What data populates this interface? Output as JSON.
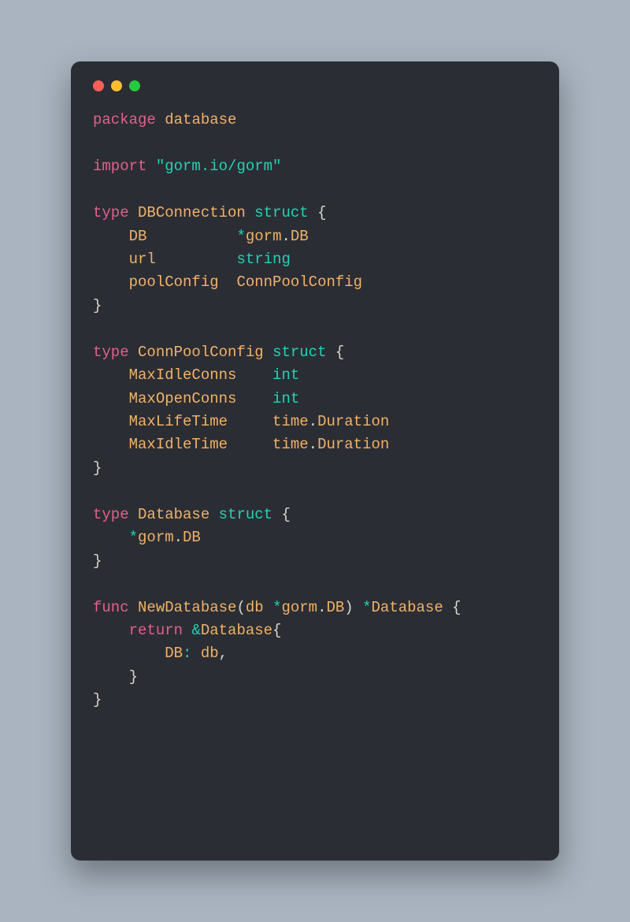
{
  "window": {
    "dots": [
      "red",
      "yellow",
      "green"
    ]
  },
  "code": {
    "l1_kw": "package",
    "l1_name": "database",
    "l3_kw": "import",
    "l3_str": "\"gorm.io/gorm\"",
    "l5_kw_type": "type",
    "l5_name": "DBConnection",
    "l5_kw_struct": "struct",
    "l6_field": "DB",
    "l6_star": "*",
    "l6_pkg": "gorm",
    "l6_dot": ".",
    "l6_type": "DB",
    "l7_field": "url",
    "l7_type": "string",
    "l8_field": "poolConfig",
    "l8_type": "ConnPoolConfig",
    "l11_kw_type": "type",
    "l11_name": "ConnPoolConfig",
    "l11_kw_struct": "struct",
    "l12_field": "MaxIdleConns",
    "l12_type": "int",
    "l13_field": "MaxOpenConns",
    "l13_type": "int",
    "l14_field": "MaxLifeTime",
    "l14_pkg": "time",
    "l14_type": "Duration",
    "l15_field": "MaxIdleTime",
    "l15_pkg": "time",
    "l15_type": "Duration",
    "l18_kw_type": "type",
    "l18_name": "Database",
    "l18_kw_struct": "struct",
    "l19_star": "*",
    "l19_pkg": "gorm",
    "l19_type": "DB",
    "l22_kw_func": "func",
    "l22_name": "NewDatabase",
    "l22_param": "db",
    "l22_star": "*",
    "l22_ppkg": "gorm",
    "l22_ptype": "DB",
    "l22_rstar": "*",
    "l22_rtype": "Database",
    "l23_kw_return": "return",
    "l23_amp": "&",
    "l23_type": "Database",
    "l24_field": "DB",
    "l24_colon": ":",
    "l24_val": "db",
    "brace_open": "{",
    "brace_close": "}",
    "paren_open": "(",
    "paren_close": ")",
    "comma": ",",
    "dot": "."
  }
}
